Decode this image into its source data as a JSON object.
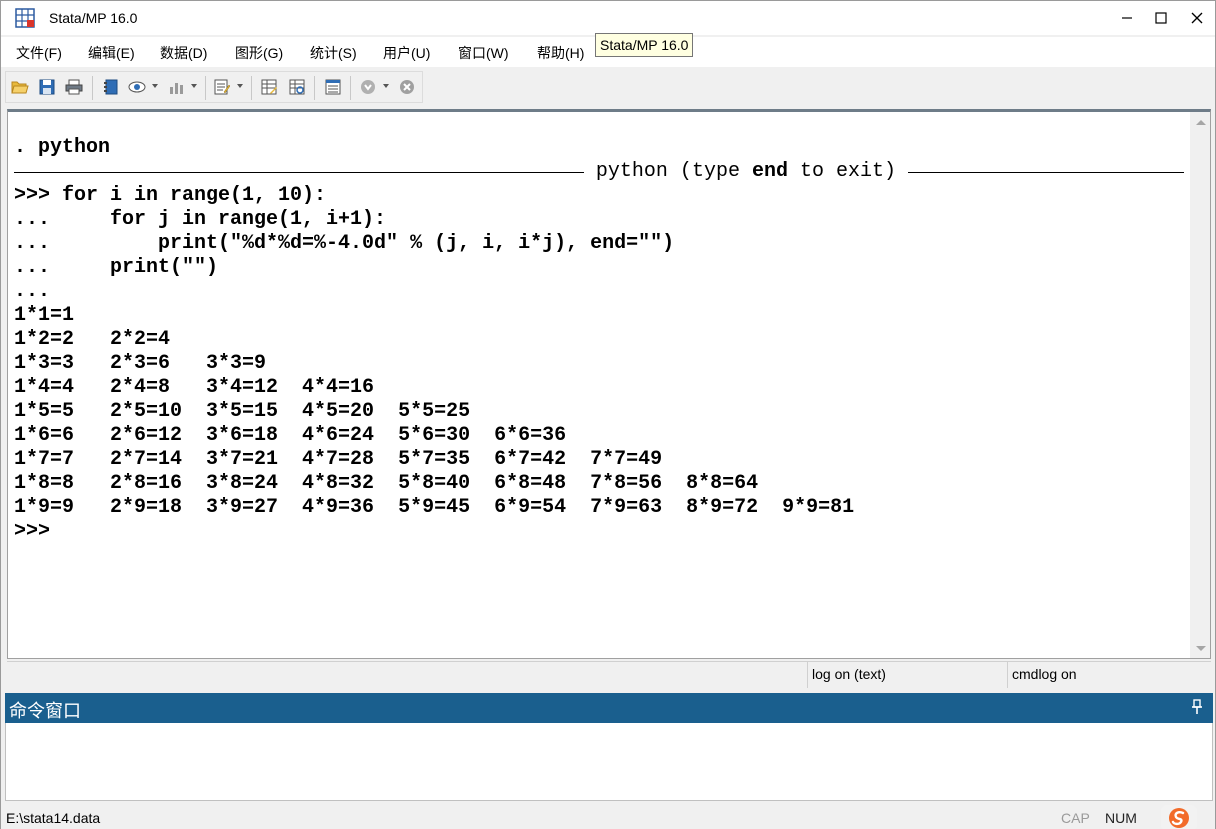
{
  "window": {
    "title": "Stata/MP 16.0",
    "controls": {
      "minimize": "—",
      "maximize": "☐",
      "close": "✕"
    }
  },
  "menu": {
    "items": [
      "文件(F)",
      "编辑(E)",
      "数据(D)",
      "图形(G)",
      "统计(S)",
      "用户(U)",
      "窗口(W)",
      "帮助(H)"
    ]
  },
  "tooltip": {
    "text": "Stata/MP 16.0"
  },
  "toolbar": {
    "icons": [
      "open-icon",
      "save-icon",
      "print-icon",
      "log-icon",
      "viewer-icon",
      "graph-icon",
      "do-file-editor-icon",
      "data-editor-icon",
      "data-browser-icon",
      "variables-manager-icon",
      "more-icon",
      "break-icon"
    ]
  },
  "results": {
    "lines": {
      "l1": ". python",
      "banner_pre": "python (type ",
      "banner_end": "end",
      "banner_post": " to exit)",
      "l3": ">>> for i in range(1, 10):",
      "l4": "...     for j in range(1, i+1):",
      "l5": "...         print(\"%d*%d=%-4.0d\" % (j, i, i*j), end=\"\")",
      "l6": "...     print(\"\")",
      "l7": "...",
      "l8": "1*1=1",
      "l9": "1*2=2   2*2=4",
      "l10": "1*3=3   2*3=6   3*3=9",
      "l11": "1*4=4   2*4=8   3*4=12  4*4=16",
      "l12": "1*5=5   2*5=10  3*5=15  4*5=20  5*5=25",
      "l13": "1*6=6   2*6=12  3*6=18  4*6=24  5*6=30  6*6=36",
      "l14": "1*7=7   2*7=14  3*7=21  4*7=28  5*7=35  6*7=42  7*7=49",
      "l15": "1*8=8   2*8=16  3*8=24  4*8=32  5*8=40  6*8=48  7*8=56  8*8=64",
      "l16": "1*9=9   2*9=18  3*9=27  4*9=36  5*9=45  6*9=54  7*9=63  8*9=72  9*9=81",
      "l17": ">>>"
    },
    "status": {
      "log": "log on (text)",
      "cmdlog": "cmdlog on"
    }
  },
  "command_window": {
    "title": "命令窗口",
    "value": ""
  },
  "statusbar": {
    "path": "E:\\stata14.data",
    "cap": "CAP",
    "num": "NUM"
  },
  "colors": {
    "command_title_bg": "#1a5f8e",
    "tooltip_bg": "#ffffe1"
  }
}
